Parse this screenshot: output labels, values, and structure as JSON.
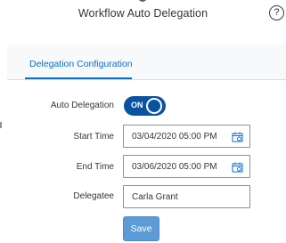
{
  "header": {
    "title": "Workflow Auto Delegation",
    "help_label": "?"
  },
  "tabs": [
    {
      "label": "Delegation Configuration",
      "selected": true
    }
  ],
  "form": {
    "auto_delegation": {
      "label": "Auto Delegation",
      "state_text": "ON",
      "enabled": true
    },
    "start_time": {
      "label": "Start Time",
      "value": "03/04/2020 05:00 PM"
    },
    "end_time": {
      "label": "End Time",
      "value": "03/06/2020 05:00 PM"
    },
    "delegatee": {
      "label": "Delegatee",
      "value": "Carla Grant"
    }
  },
  "actions": {
    "save_label": "Save"
  },
  "colors": {
    "accent": "#0a6ed1",
    "toggle_on": "#0854a0",
    "save_button": "#5d9bd6"
  }
}
